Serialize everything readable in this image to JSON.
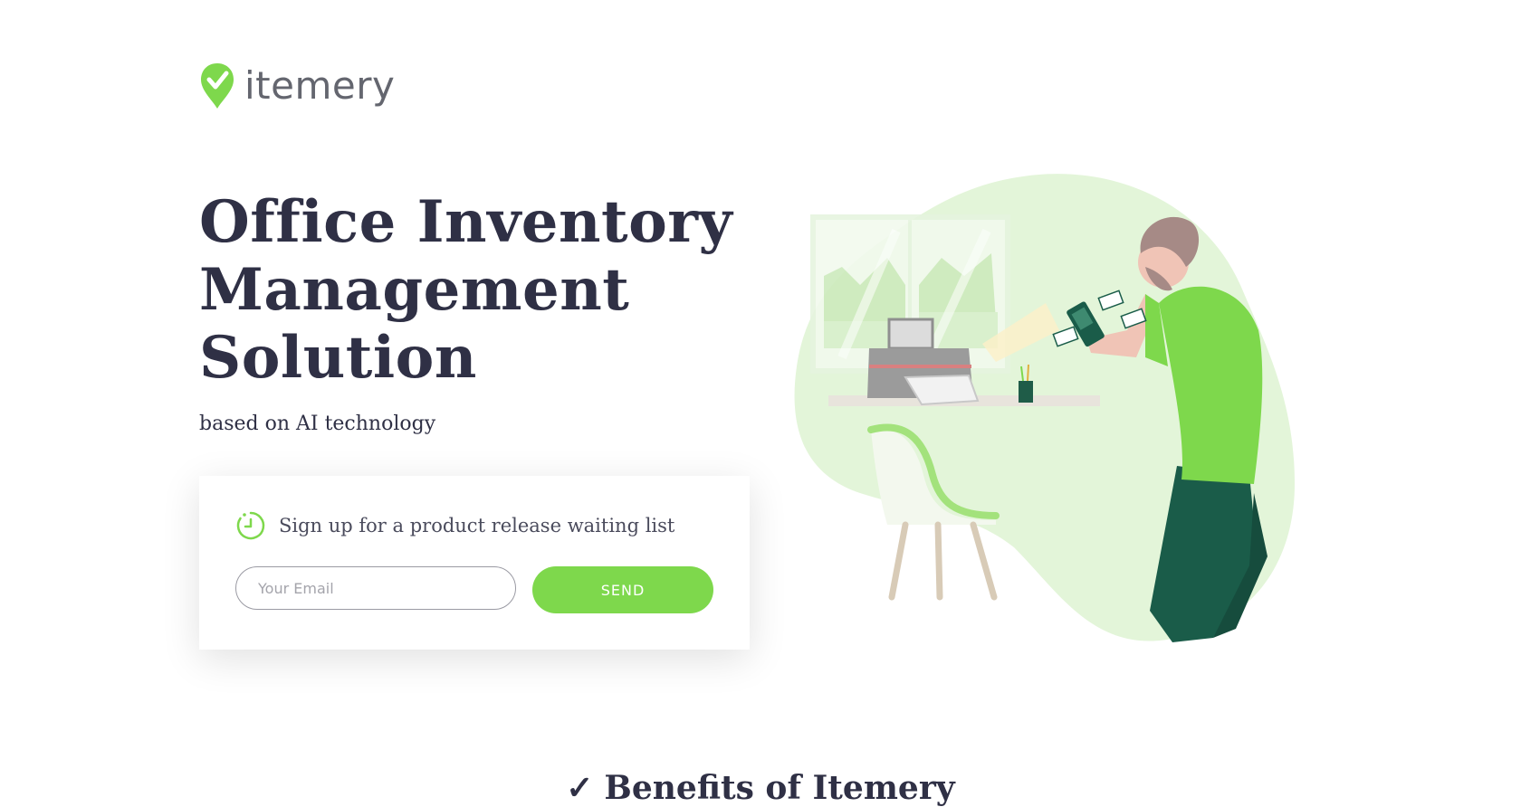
{
  "brand": {
    "name": "itemery",
    "accent": "#7ED84C",
    "text_color": "#2F3045",
    "logo_color": "#64666F"
  },
  "hero": {
    "title_lines": [
      "Office Inventory",
      "Management",
      "Solution"
    ],
    "subtitle": "based on AI technology"
  },
  "signup": {
    "icon": "clock-icon",
    "title": "Sign up for a product release waiting list",
    "email_placeholder": "Your Email",
    "email_value": "",
    "send_label": "SEND"
  },
  "illustration": {
    "name": "office-worker-scanning-illustration"
  },
  "next_section": {
    "icon": "check-icon",
    "title": "Benefits of Itemery"
  }
}
